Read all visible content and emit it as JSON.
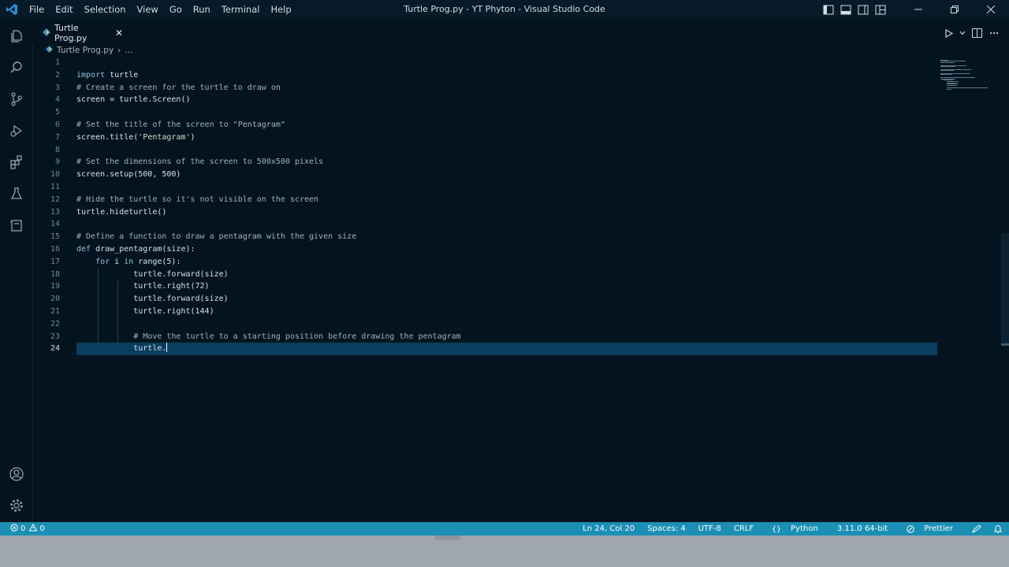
{
  "titlebar": {
    "menu": [
      "File",
      "Edit",
      "Selection",
      "View",
      "Go",
      "Run",
      "Terminal",
      "Help"
    ],
    "window_title": "Turtle Prog.py - YT Phyton - Visual Studio Code"
  },
  "activity_bar": {
    "icons": [
      "explorer-icon",
      "search-icon",
      "source-control-icon",
      "run-debug-icon",
      "extensions-icon",
      "testing-icon",
      "remote-explorer-icon",
      "account-icon",
      "manage-gear-icon"
    ]
  },
  "tab": {
    "label": "Turtle Prog.py",
    "close_glyph": "✕"
  },
  "breadcrumb": {
    "file": "Turtle Prog.py",
    "separator": "›",
    "ellipsis": "..."
  },
  "code_lines": [
    "",
    "import turtle",
    "# Create a screen for the turtle to draw on",
    "screen = turtle.Screen()",
    "",
    "# Set the title of the screen to \"Pentagram\"",
    "screen.title('Pentagram')",
    "",
    "# Set the dimensions of the screen to 500x500 pixels",
    "screen.setup(500, 500)",
    "",
    "# Hide the turtle so it's not visible on the screen",
    "turtle.hideturtle()",
    "",
    "# Define a function to draw a pentagram with the given size",
    "def draw_pentagram(size):",
    "    for i in range(5):",
    "            turtle.forward(size)",
    "            turtle.right(72)",
    "            turtle.forward(size)",
    "            turtle.right(144)",
    "",
    "            # Move the turtle to a starting position before drawing the pentagram",
    "            turtle."
  ],
  "cursor": {
    "line": 24,
    "column": 20
  },
  "statusbar": {
    "errors": "0",
    "warnings": "0",
    "position": "Ln 24, Col 20",
    "spaces": "Spaces: 4",
    "encoding": "UTF-8",
    "eol": "CRLF",
    "language": "Python",
    "interpreter": "3.11.0 64-bit",
    "formatter": "Prettier"
  },
  "colors": {
    "background": "#04141f",
    "status_bar": "#1b8fb4",
    "current_line": "#083e5e",
    "accent": "#2a8dd4"
  }
}
